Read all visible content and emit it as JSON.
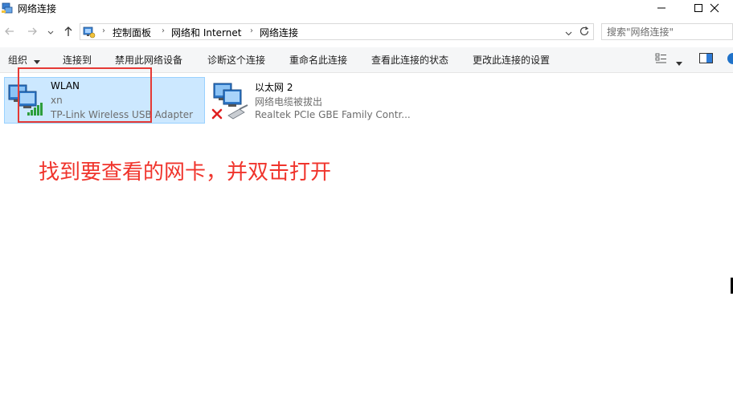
{
  "window": {
    "title": "网络连接",
    "controls": {
      "minimize": "—",
      "maximize": "☐",
      "close": "✕"
    }
  },
  "address": {
    "crumbs": [
      "控制面板",
      "网络和 Internet",
      "网络连接"
    ],
    "search_placeholder": "搜索\"网络连接\""
  },
  "toolbar": {
    "organize": "组织",
    "connect_to": "连接到",
    "disable_device": "禁用此网络设备",
    "diagnose": "诊断这个连接",
    "rename": "重命名此连接",
    "view_status": "查看此连接的状态",
    "change_settings": "更改此连接的设置"
  },
  "connections": [
    {
      "name": "WLAN",
      "status": "xn",
      "adapter": "TP-Link Wireless USB Adapter",
      "selected": true
    },
    {
      "name": "以太网 2",
      "status": "网络电缆被拔出",
      "adapter": "Realtek PCIe GBE Family Contr...",
      "selected": false
    }
  ],
  "annotation": {
    "text": "找到要查看的网卡，并双击打开",
    "color": "#f0342c"
  },
  "colors": {
    "selection_bg": "#cce8ff",
    "selection_border": "#99d1ff",
    "annotation_box": "#e53935"
  }
}
